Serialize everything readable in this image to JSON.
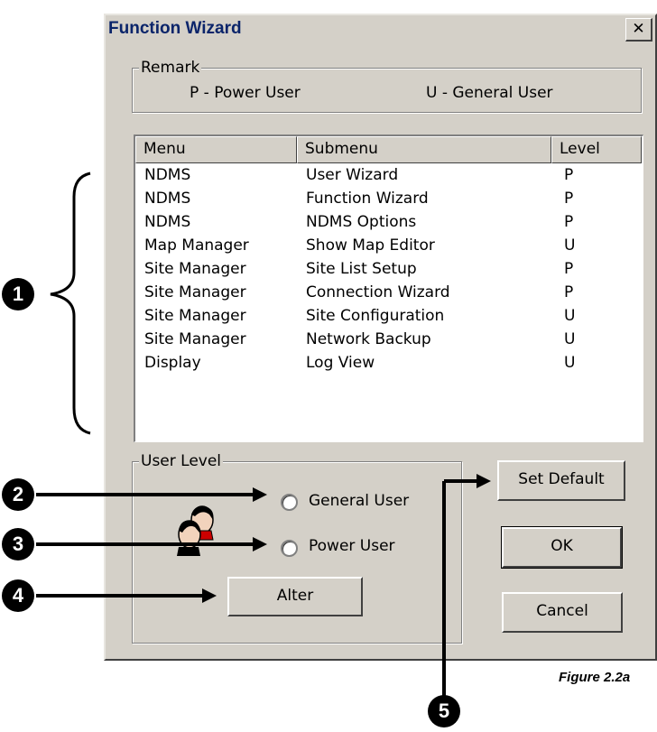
{
  "dialog": {
    "title": "Function Wizard",
    "close_glyph": "✕",
    "remark": {
      "label": "Remark",
      "power_user": "P - Power User",
      "general_user": "U - General User"
    },
    "table": {
      "columns": [
        "Menu",
        "Submenu",
        "Level"
      ],
      "rows": [
        [
          "NDMS",
          "User Wizard",
          "P"
        ],
        [
          "NDMS",
          "Function Wizard",
          "P"
        ],
        [
          "NDMS",
          "NDMS Options",
          "P"
        ],
        [
          "Map Manager",
          "Show Map Editor",
          "U"
        ],
        [
          "Site Manager",
          "Site List Setup",
          "P"
        ],
        [
          "Site Manager",
          "Connection Wizard",
          "P"
        ],
        [
          "Site Manager",
          "Site Configuration",
          "U"
        ],
        [
          "Site Manager",
          "Network Backup",
          "U"
        ],
        [
          "Display",
          "Log View",
          "U"
        ]
      ]
    },
    "user_level": {
      "label": "User Level",
      "general_user": "General User",
      "power_user": "Power User",
      "alter_label": "Alter"
    },
    "buttons": {
      "set_default": "Set Default",
      "ok": "OK",
      "cancel": "Cancel"
    }
  },
  "annotations": {
    "callouts": [
      "1",
      "2",
      "3",
      "4",
      "5"
    ],
    "caption": "Figure 2.2a"
  },
  "icons": [
    "close-icon",
    "users-icon",
    "radio-icon"
  ]
}
